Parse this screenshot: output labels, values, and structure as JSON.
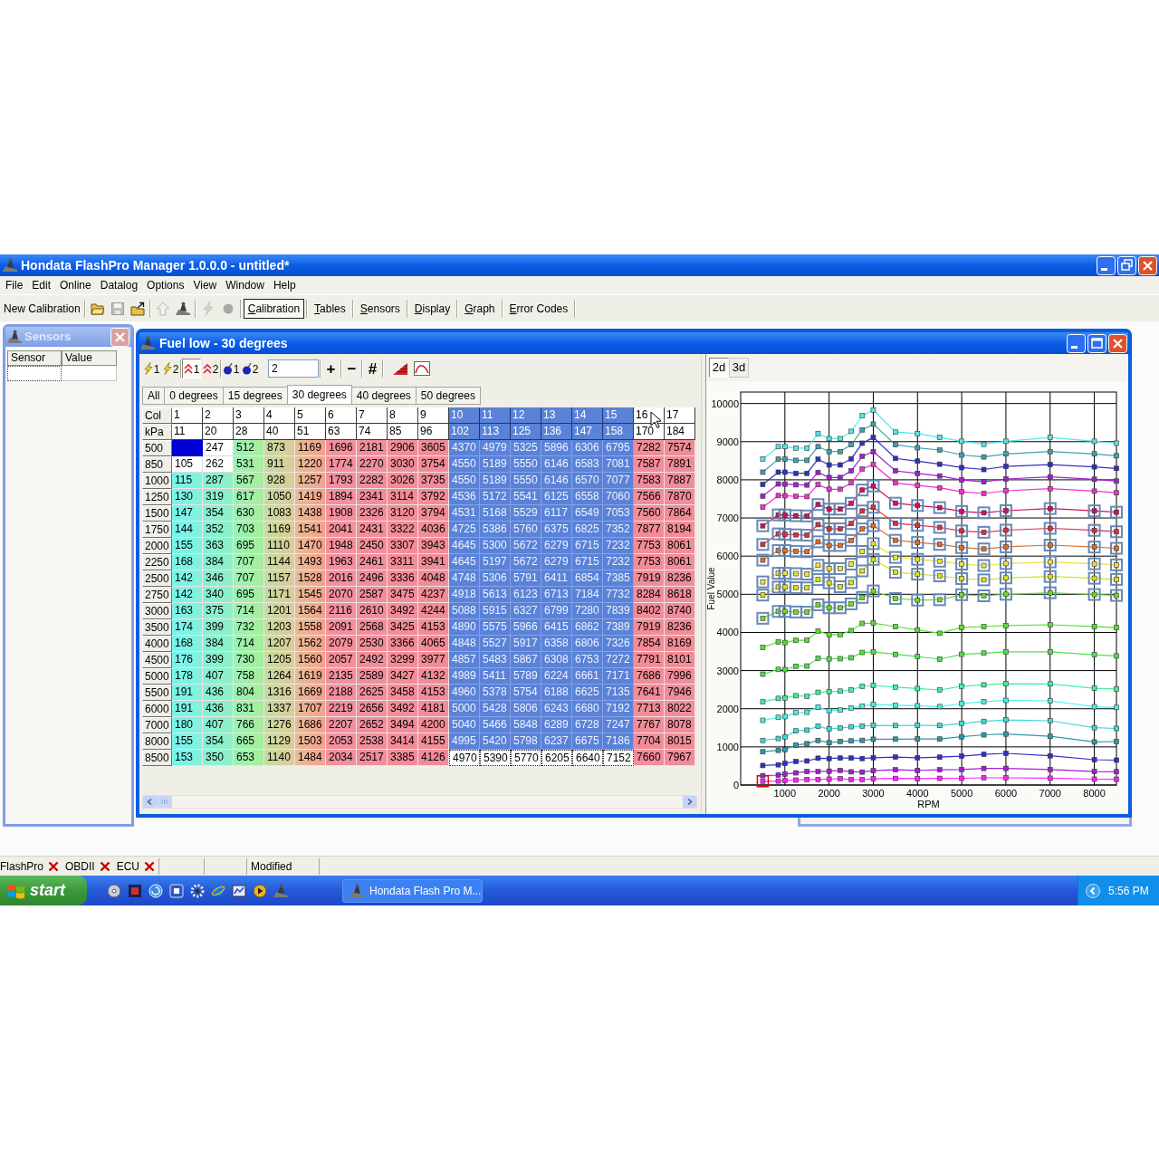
{
  "window": {
    "title": "Hondata FlashPro Manager 1.0.0.0 - untitled*"
  },
  "menu_bar": [
    "File",
    "Edit",
    "Online",
    "Datalog",
    "Options",
    "View",
    "Window",
    "Help"
  ],
  "toolbar": {
    "new_button": "New Calibration",
    "icon_buttons": [
      {
        "disabled": false
      },
      {
        "disabled": true
      },
      {
        "disabled": false
      },
      {
        "disabled": true
      },
      {
        "disabled": false
      },
      {
        "disabled": true
      },
      {
        "disabled": true
      }
    ],
    "view_buttons": [
      {
        "label": "Calibration",
        "selected": true
      },
      {
        "label": "Tables",
        "selected": false
      },
      {
        "label": "Sensors",
        "selected": false
      },
      {
        "label": "Display",
        "selected": false
      },
      {
        "label": "Graph",
        "selected": false
      },
      {
        "label": "Error Codes",
        "selected": false
      }
    ]
  },
  "sensors_window": {
    "title": "Sensors",
    "columns": [
      "Sensor",
      "Value"
    ]
  },
  "table_window": {
    "title": "Fuel low - 30 degrees",
    "toggle_buttons": [
      {
        "label": "1",
        "pressed": false
      },
      {
        "label": "2",
        "pressed": false
      },
      {
        "label": "1",
        "pressed": true
      },
      {
        "label": "2",
        "pressed": false
      },
      {
        "label": "1",
        "pressed": false
      },
      {
        "label": "2",
        "pressed": false
      }
    ],
    "step_field": {
      "value": "2"
    },
    "step_buttons": [
      "+",
      "−",
      "#"
    ],
    "tabs": [
      {
        "label": "All",
        "selected": false
      },
      {
        "label": "0 degrees",
        "selected": false
      },
      {
        "label": "15 degrees",
        "selected": false
      },
      {
        "label": "30 degrees",
        "selected": true
      },
      {
        "label": "40 degrees",
        "selected": false
      },
      {
        "label": "50 degrees",
        "selected": false
      }
    ],
    "table": {
      "corner_labels": [
        "Col",
        "kPa"
      ],
      "columns": [
        {
          "label": "1",
          "kpa": "11",
          "selected": false,
          "marked": true,
          "cursor": true
        },
        {
          "label": "2",
          "kpa": "20",
          "selected": false,
          "marked": true,
          "cursor": false
        },
        {
          "label": "3",
          "kpa": "28",
          "selected": false,
          "marked": false,
          "cursor": false
        },
        {
          "label": "4",
          "kpa": "40",
          "selected": false,
          "marked": false,
          "cursor": false
        },
        {
          "label": "5",
          "kpa": "51",
          "selected": false,
          "marked": false,
          "cursor": false
        },
        {
          "label": "6",
          "kpa": "63",
          "selected": false,
          "marked": false,
          "cursor": false
        },
        {
          "label": "7",
          "kpa": "74",
          "selected": false,
          "marked": false,
          "cursor": false
        },
        {
          "label": "8",
          "kpa": "85",
          "selected": false,
          "marked": false,
          "cursor": false
        },
        {
          "label": "9",
          "kpa": "96",
          "selected": false,
          "marked": false,
          "cursor": false
        },
        {
          "label": "10",
          "kpa": "102",
          "selected": true,
          "marked": false,
          "cursor": false
        },
        {
          "label": "11",
          "kpa": "113",
          "selected": true,
          "marked": false,
          "cursor": false
        },
        {
          "label": "12",
          "kpa": "125",
          "selected": true,
          "marked": false,
          "cursor": false
        },
        {
          "label": "13",
          "kpa": "136",
          "selected": true,
          "marked": false,
          "cursor": false
        },
        {
          "label": "14",
          "kpa": "147",
          "selected": true,
          "marked": false,
          "cursor": false
        },
        {
          "label": "15",
          "kpa": "158",
          "selected": true,
          "marked": false,
          "cursor": false
        },
        {
          "label": "16",
          "kpa": "170",
          "selected": false,
          "marked": false,
          "cursor": false
        },
        {
          "label": "17",
          "kpa": "184",
          "selected": false,
          "marked": false,
          "cursor": false
        }
      ],
      "rows": [
        {
          "rpm": "500",
          "outlined": false,
          "marked": true,
          "cursor": true,
          "cells": [
            null,
            "247",
            "512",
            "873",
            "1169",
            "1696",
            "2181",
            "2906",
            "3605",
            "4370",
            "4979",
            "5325",
            "5896",
            "6306",
            "6795",
            "7282",
            "7574"
          ]
        },
        {
          "rpm": "850",
          "outlined": false,
          "marked": true,
          "cursor": false,
          "cells": [
            "105",
            "262",
            "531",
            "911",
            "1220",
            "1774",
            "2270",
            "3030",
            "3754",
            "4550",
            "5189",
            "5550",
            "6146",
            "6583",
            "7081",
            "7587",
            "7891"
          ]
        },
        {
          "rpm": "1000",
          "outlined": false,
          "marked": false,
          "cursor": false,
          "cells": [
            "115",
            "287",
            "567",
            "928",
            "1257",
            "1793",
            "2282",
            "3026",
            "3735",
            "4550",
            "5189",
            "5550",
            "6146",
            "6570",
            "7077",
            "7583",
            "7887"
          ]
        },
        {
          "rpm": "1250",
          "outlined": false,
          "marked": false,
          "cursor": false,
          "cells": [
            "130",
            "319",
            "617",
            "1050",
            "1419",
            "1894",
            "2341",
            "3114",
            "3792",
            "4536",
            "5172",
            "5541",
            "6125",
            "6558",
            "7060",
            "7566",
            "7870"
          ]
        },
        {
          "rpm": "1500",
          "outlined": false,
          "marked": false,
          "cursor": false,
          "cells": [
            "147",
            "354",
            "630",
            "1083",
            "1438",
            "1908",
            "2326",
            "3120",
            "3794",
            "4531",
            "5168",
            "5529",
            "6117",
            "6549",
            "7053",
            "7560",
            "7864"
          ]
        },
        {
          "rpm": "1750",
          "outlined": false,
          "marked": false,
          "cursor": false,
          "cells": [
            "144",
            "352",
            "703",
            "1169",
            "1541",
            "2041",
            "2431",
            "3322",
            "4036",
            "4725",
            "5386",
            "5760",
            "6375",
            "6825",
            "7352",
            "7877",
            "8194"
          ]
        },
        {
          "rpm": "2000",
          "outlined": false,
          "marked": false,
          "cursor": false,
          "cells": [
            "155",
            "363",
            "695",
            "1110",
            "1470",
            "1948",
            "2450",
            "3307",
            "3943",
            "4645",
            "5300",
            "5672",
            "6279",
            "6715",
            "7232",
            "7753",
            "8061"
          ]
        },
        {
          "rpm": "2250",
          "outlined": false,
          "marked": false,
          "cursor": false,
          "cells": [
            "168",
            "384",
            "707",
            "1144",
            "1493",
            "1963",
            "2461",
            "3311",
            "3941",
            "4645",
            "5197",
            "5672",
            "6279",
            "6715",
            "7232",
            "7753",
            "8061"
          ]
        },
        {
          "rpm": "2500",
          "outlined": false,
          "marked": false,
          "cursor": false,
          "cells": [
            "142",
            "346",
            "707",
            "1157",
            "1528",
            "2016",
            "2496",
            "3336",
            "4048",
            "4748",
            "5306",
            "5791",
            "6411",
            "6854",
            "7385",
            "7919",
            "8236"
          ]
        },
        {
          "rpm": "2750",
          "outlined": false,
          "marked": false,
          "cursor": false,
          "cells": [
            "142",
            "340",
            "695",
            "1171",
            "1545",
            "2070",
            "2587",
            "3475",
            "4237",
            "4918",
            "5613",
            "6123",
            "6713",
            "7184",
            "7732",
            "8284",
            "8618"
          ]
        },
        {
          "rpm": "3000",
          "outlined": false,
          "marked": false,
          "cursor": false,
          "cells": [
            "163",
            "375",
            "714",
            "1201",
            "1564",
            "2116",
            "2610",
            "3492",
            "4244",
            "5088",
            "5915",
            "6327",
            "6799",
            "7280",
            "7839",
            "8402",
            "8740"
          ]
        },
        {
          "rpm": "3500",
          "outlined": false,
          "marked": false,
          "cursor": false,
          "cells": [
            "174",
            "399",
            "732",
            "1203",
            "1558",
            "2091",
            "2568",
            "3425",
            "4153",
            "4890",
            "5575",
            "5966",
            "6415",
            "6862",
            "7389",
            "7919",
            "8236"
          ]
        },
        {
          "rpm": "4000",
          "outlined": false,
          "marked": false,
          "cursor": false,
          "cells": [
            "168",
            "384",
            "714",
            "1207",
            "1562",
            "2079",
            "2530",
            "3366",
            "4065",
            "4848",
            "5527",
            "5917",
            "6358",
            "6806",
            "7326",
            "7854",
            "8169"
          ]
        },
        {
          "rpm": "4500",
          "outlined": false,
          "marked": false,
          "cursor": false,
          "cells": [
            "176",
            "399",
            "730",
            "1205",
            "1560",
            "2057",
            "2492",
            "3299",
            "3977",
            "4857",
            "5483",
            "5867",
            "6308",
            "6753",
            "7272",
            "7791",
            "8101"
          ]
        },
        {
          "rpm": "5000",
          "outlined": false,
          "marked": false,
          "cursor": false,
          "cells": [
            "178",
            "407",
            "758",
            "1264",
            "1619",
            "2135",
            "2589",
            "3427",
            "4132",
            "4989",
            "5411",
            "5789",
            "6224",
            "6661",
            "7171",
            "7686",
            "7996"
          ]
        },
        {
          "rpm": "5500",
          "outlined": false,
          "marked": false,
          "cursor": false,
          "cells": [
            "191",
            "436",
            "804",
            "1316",
            "1669",
            "2188",
            "2625",
            "3458",
            "4153",
            "4960",
            "5378",
            "5754",
            "6188",
            "6625",
            "7135",
            "7641",
            "7946"
          ]
        },
        {
          "rpm": "6000",
          "outlined": false,
          "marked": false,
          "cursor": false,
          "cells": [
            "191",
            "436",
            "831",
            "1337",
            "1707",
            "2219",
            "2656",
            "3492",
            "4181",
            "5000",
            "5428",
            "5806",
            "6243",
            "6680",
            "7192",
            "7713",
            "8022"
          ]
        },
        {
          "rpm": "7000",
          "outlined": false,
          "marked": false,
          "cursor": false,
          "cells": [
            "180",
            "407",
            "766",
            "1276",
            "1686",
            "2207",
            "2652",
            "3494",
            "4200",
            "5040",
            "5466",
            "5848",
            "6289",
            "6728",
            "7247",
            "7767",
            "8078"
          ]
        },
        {
          "rpm": "8000",
          "outlined": false,
          "marked": false,
          "cursor": false,
          "cells": [
            "155",
            "354",
            "665",
            "1129",
            "1503",
            "2053",
            "2538",
            "3414",
            "4155",
            "4995",
            "5420",
            "5798",
            "6237",
            "6675",
            "7186",
            "7704",
            "8015"
          ]
        },
        {
          "rpm": "8500",
          "outlined": true,
          "marked": false,
          "cursor": false,
          "cells": [
            "153",
            "350",
            "653",
            "1140",
            "1484",
            "2034",
            "2517",
            "3385",
            "4126",
            "4970",
            "5390",
            "5770",
            "6205",
            "6640",
            "7152",
            "7660",
            "7967"
          ]
        }
      ]
    },
    "graph": {
      "tabs": [
        {
          "label": "2d",
          "selected": true
        },
        {
          "label": "3d",
          "selected": false
        }
      ],
      "chart_data": {
        "type": "line",
        "xlabel": "RPM",
        "ylabel": "Fuel Value",
        "grid": true,
        "x": [
          500,
          850,
          1000,
          1250,
          1500,
          1750,
          2000,
          2250,
          2500,
          2750,
          3000,
          3500,
          4000,
          4500,
          5000,
          5500,
          6000,
          7000,
          8000,
          8500
        ],
        "xlim": [
          0,
          8500
        ],
        "ylim": [
          0,
          10300
        ],
        "xticks": [
          1000,
          2000,
          3000,
          4000,
          5000,
          6000,
          7000,
          8000
        ],
        "yticks": [
          0,
          1000,
          2000,
          3000,
          4000,
          5000,
          6000,
          7000,
          8000,
          9000,
          10000
        ],
        "series": [
          {
            "color": "#ff20ff",
            "marker": "square",
            "values": [
              100,
              105,
              115,
              130,
              147,
              144,
              155,
              168,
              142,
              142,
              163,
              174,
              168,
              176,
              178,
              191,
              191,
              180,
              155,
              153
            ]
          },
          {
            "color": "#a020d0",
            "marker": "square",
            "values": [
              247,
              262,
              287,
              319,
              354,
              352,
              363,
              384,
              346,
              340,
              375,
              399,
              384,
              399,
              407,
              436,
              436,
              407,
              354,
              350
            ]
          },
          {
            "color": "#3030c8",
            "marker": "square",
            "values": [
              512,
              531,
              567,
              617,
              630,
              703,
              695,
              707,
              707,
              695,
              714,
              732,
              714,
              730,
              758,
              804,
              831,
              766,
              665,
              653
            ]
          },
          {
            "color": "#3098a8",
            "marker": "square",
            "values": [
              873,
              911,
              928,
              1050,
              1083,
              1169,
              1110,
              1144,
              1157,
              1171,
              1201,
              1203,
              1207,
              1205,
              1264,
              1316,
              1337,
              1276,
              1129,
              1140
            ]
          },
          {
            "color": "#40d8d8",
            "marker": "square",
            "values": [
              1169,
              1220,
              1257,
              1419,
              1438,
              1541,
              1470,
              1493,
              1528,
              1545,
              1564,
              1558,
              1562,
              1560,
              1619,
              1669,
              1707,
              1686,
              1503,
              1484
            ]
          },
          {
            "color": "#48f0e8",
            "marker": "square",
            "values": [
              1696,
              1774,
              1793,
              1894,
              1908,
              2041,
              1948,
              1963,
              2016,
              2070,
              2116,
              2091,
              2079,
              2057,
              2135,
              2188,
              2219,
              2207,
              2053,
              2034
            ]
          },
          {
            "color": "#40f0a0",
            "marker": "square",
            "values": [
              2181,
              2270,
              2282,
              2341,
              2326,
              2431,
              2450,
              2461,
              2496,
              2587,
              2610,
              2568,
              2530,
              2492,
              2589,
              2625,
              2656,
              2652,
              2538,
              2517
            ]
          },
          {
            "color": "#50e050",
            "marker": "square",
            "values": [
              2906,
              3030,
              3026,
              3114,
              3120,
              3322,
              3307,
              3311,
              3336,
              3475,
              3492,
              3425,
              3366,
              3299,
              3427,
              3458,
              3492,
              3494,
              3414,
              3385
            ]
          },
          {
            "color": "#58e030",
            "marker": "square",
            "values": [
              3605,
              3754,
              3735,
              3792,
              3794,
              4036,
              3943,
              3941,
              4048,
              4237,
              4244,
              4153,
              4065,
              3977,
              4132,
              4153,
              4181,
              4200,
              4155,
              4126
            ]
          },
          {
            "color": "#70d830",
            "marker": "square",
            "values": [
              4370,
              4550,
              4550,
              4536,
              4531,
              4725,
              4645,
              4645,
              4748,
              4918,
              5088,
              4890,
              4848,
              4857,
              4989,
              4960,
              5000,
              5040,
              4995,
              4970
            ]
          },
          {
            "color": "#d8e020",
            "marker": "square",
            "values": [
              4979,
              5189,
              5189,
              5172,
              5168,
              5386,
              5300,
              5197,
              5306,
              5613,
              5915,
              5575,
              5527,
              5483,
              5411,
              5378,
              5428,
              5466,
              5420,
              5390
            ]
          },
          {
            "color": "#e8e040",
            "marker": "square",
            "values": [
              5325,
              5550,
              5550,
              5541,
              5529,
              5760,
              5672,
              5672,
              5791,
              6123,
              6327,
              5966,
              5917,
              5867,
              5789,
              5754,
              5806,
              5848,
              5798,
              5770
            ]
          },
          {
            "color": "#d87030",
            "marker": "square",
            "values": [
              5896,
              6146,
              6146,
              6125,
              6117,
              6375,
              6279,
              6279,
              6411,
              6713,
              6799,
              6415,
              6358,
              6308,
              6224,
              6188,
              6243,
              6289,
              6237,
              6205
            ]
          },
          {
            "color": "#d83040",
            "marker": "square",
            "values": [
              6306,
              6583,
              6570,
              6558,
              6549,
              6825,
              6715,
              6715,
              6854,
              7184,
              7280,
              6862,
              6806,
              6753,
              6661,
              6625,
              6680,
              6728,
              6675,
              6640
            ]
          },
          {
            "color": "#d01060",
            "marker": "square",
            "values": [
              6795,
              7081,
              7077,
              7060,
              7053,
              7352,
              7232,
              7232,
              7385,
              7732,
              7839,
              7389,
              7326,
              7272,
              7171,
              7135,
              7192,
              7247,
              7186,
              7152
            ]
          },
          {
            "color": "#f030d0",
            "marker": "square",
            "values": [
              7282,
              7587,
              7583,
              7566,
              7560,
              7877,
              7753,
              7753,
              7919,
              8284,
              8402,
              7919,
              7854,
              7791,
              7686,
              7641,
              7713,
              7767,
              7704,
              7660
            ]
          },
          {
            "color": "#a020d0",
            "marker": "square",
            "values": [
              7574,
              7891,
              7887,
              7870,
              7864,
              8194,
              8061,
              8061,
              8236,
              8618,
              8740,
              8236,
              8169,
              8101,
              7996,
              7946,
              8022,
              8078,
              8015,
              7967
            ]
          },
          {
            "color": "#3030c0",
            "marker": "square",
            "values": [
              7880,
              8200,
              8200,
              8170,
              8170,
              8540,
              8390,
              8390,
              8550,
              8960,
              9110,
              8560,
              8490,
              8410,
              8320,
              8270,
              8350,
              8400,
              8340,
              8300
            ]
          },
          {
            "color": "#40a0b0",
            "marker": "square",
            "values": [
              8200,
              8540,
              8540,
              8510,
              8510,
              8870,
              8740,
              8740,
              8920,
              9310,
              9460,
              8920,
              8840,
              8780,
              8650,
              8600,
              8680,
              8740,
              8680,
              8630
            ]
          },
          {
            "color": "#50e8e8",
            "marker": "square",
            "values": [
              8540,
              8870,
              8870,
              8830,
              8830,
              9210,
              9080,
              9080,
              9270,
              9680,
              9830,
              9250,
              9210,
              9110,
              9010,
              8930,
              9010,
              9110,
              9010,
              8960
            ]
          }
        ]
      }
    }
  },
  "status_bar": {
    "connections": [
      {
        "label": "FlashPro",
        "connected": false
      },
      {
        "label": "OBDII",
        "connected": false
      },
      {
        "label": "ECU",
        "connected": false
      }
    ],
    "state": "Modified"
  },
  "taskbar": {
    "start": "start",
    "task": "Hondata Flash Pro M...",
    "clock": "5:56 PM"
  }
}
